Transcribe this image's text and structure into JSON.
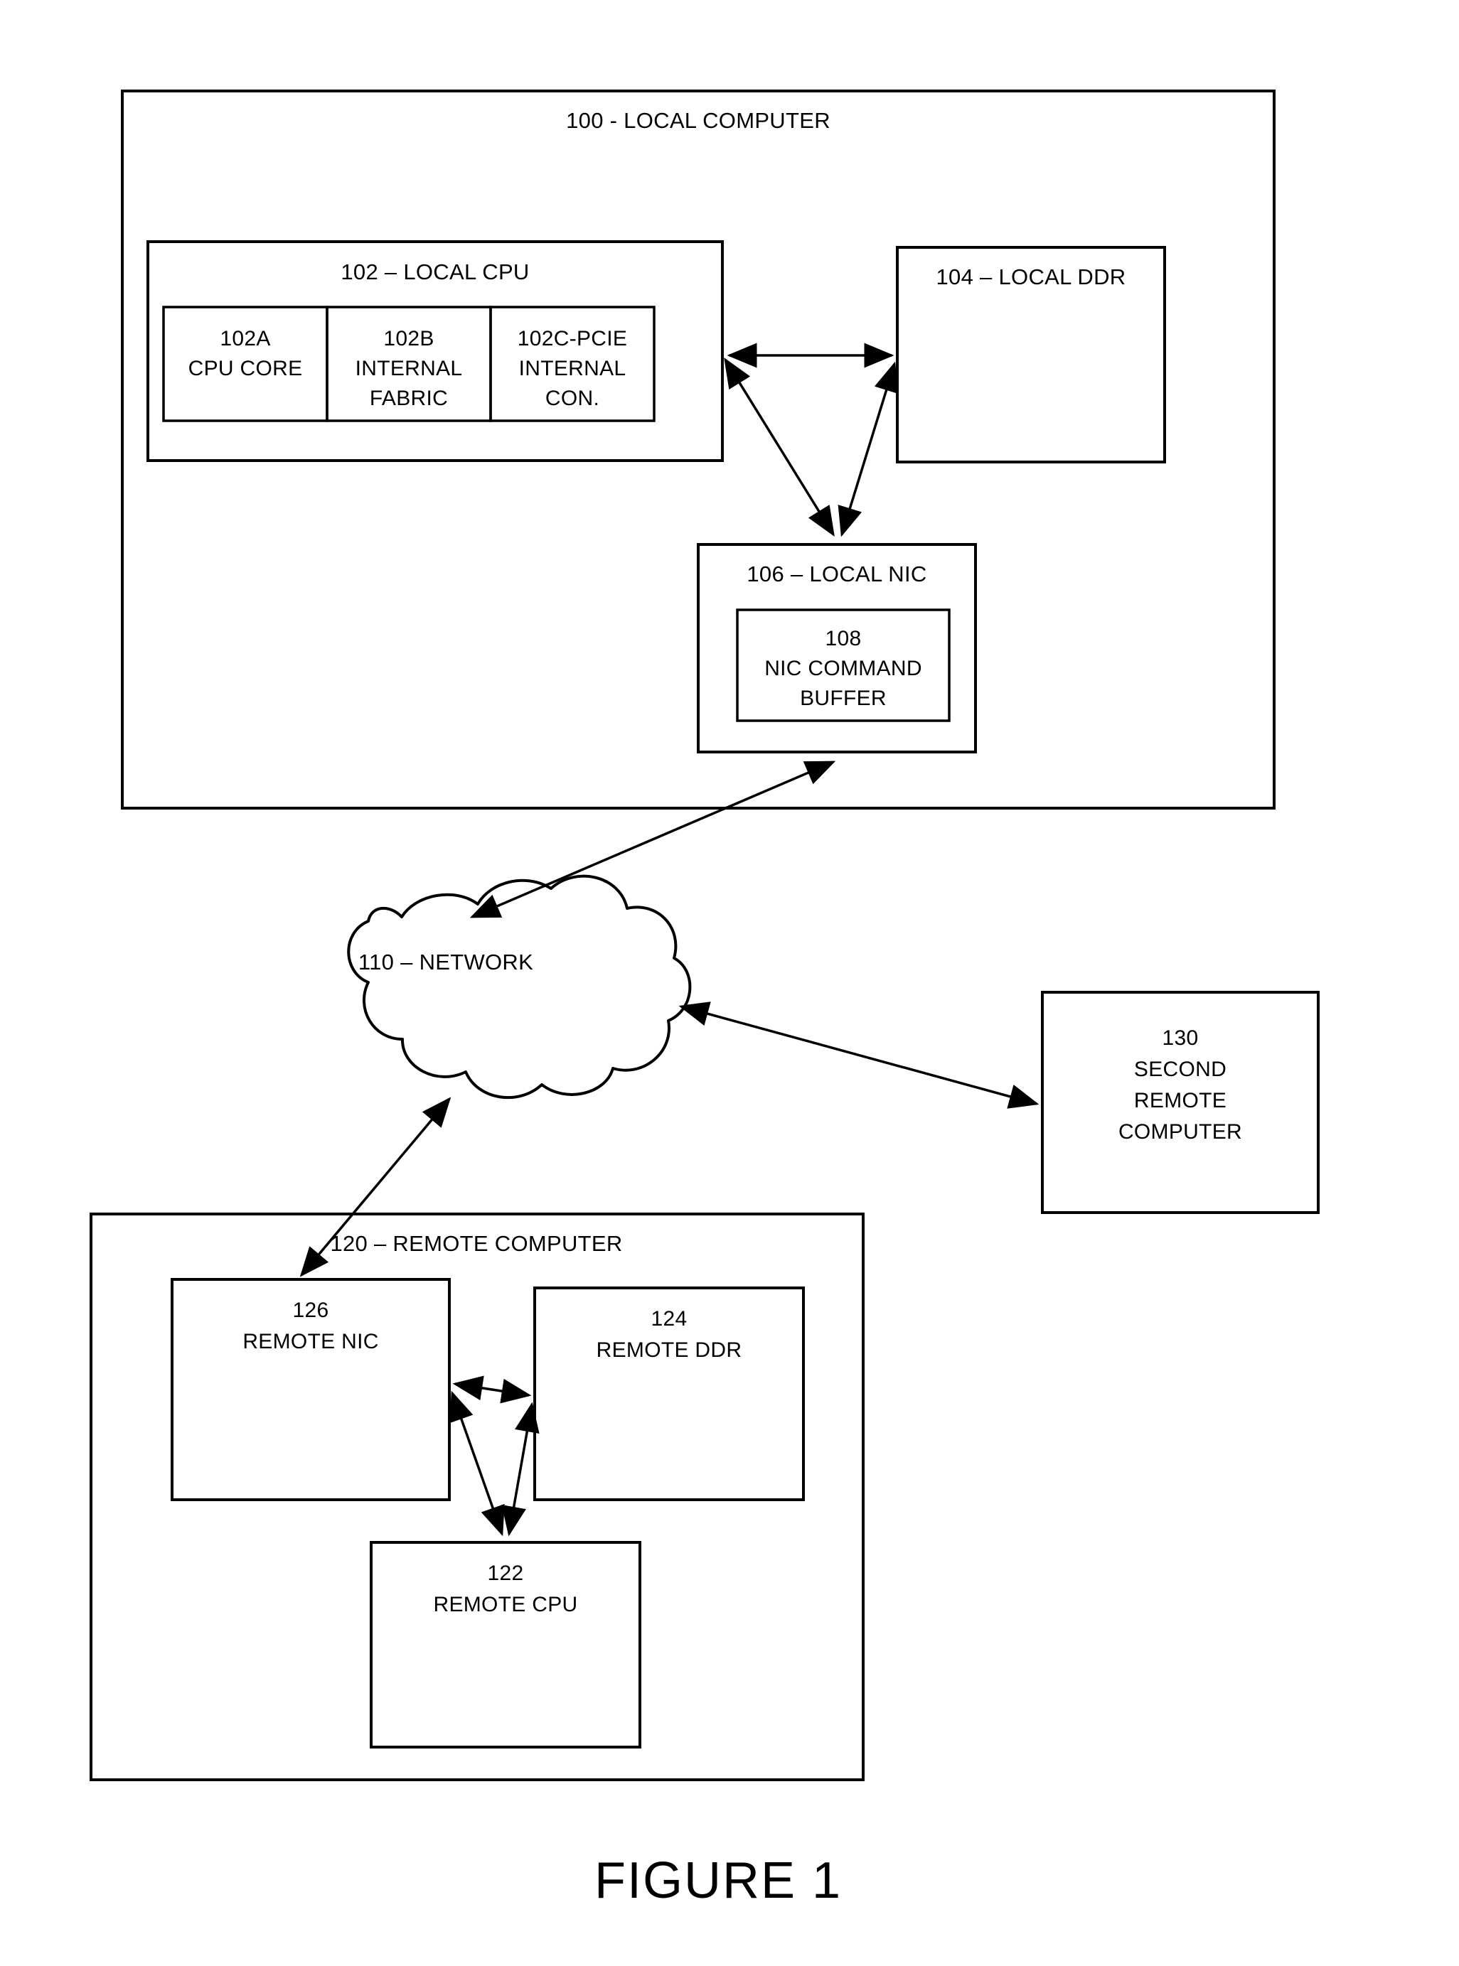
{
  "figure": {
    "caption": "FIGURE 1"
  },
  "local_computer": {
    "title": "100 - LOCAL COMPUTER",
    "cpu": {
      "title": "102 – LOCAL CPU",
      "blocks": [
        {
          "id": "102A",
          "line1": "102A",
          "line2": "CPU CORE",
          "line3": ""
        },
        {
          "id": "102B",
          "line1": "102B",
          "line2": "INTERNAL",
          "line3": "FABRIC"
        },
        {
          "id": "102C",
          "line1": "102C-PCIE",
          "line2": "INTERNAL",
          "line3": "CON."
        }
      ]
    },
    "ddr": {
      "title": "104 – LOCAL DDR"
    },
    "nic": {
      "title": "106 – LOCAL NIC",
      "command_buffer": {
        "line1": "108",
        "line2": "NIC COMMAND",
        "line3": "BUFFER"
      }
    }
  },
  "network": {
    "title": "110 – NETWORK"
  },
  "second_remote_computer": {
    "line1": "130",
    "line2": "SECOND",
    "line3": "REMOTE",
    "line4": "COMPUTER"
  },
  "remote_computer": {
    "title": "120 – REMOTE COMPUTER",
    "nic": {
      "line1": "126",
      "line2": "REMOTE NIC"
    },
    "ddr": {
      "line1": "124",
      "line2": "REMOTE DDR"
    },
    "cpu": {
      "line1": "122",
      "line2": "REMOTE CPU"
    }
  },
  "connections": [
    {
      "name": "local-cpu-to-local-ddr",
      "type": "bidirectional"
    },
    {
      "name": "local-cpu-to-local-nic",
      "type": "bidirectional"
    },
    {
      "name": "local-ddr-to-local-nic",
      "type": "bidirectional"
    },
    {
      "name": "local-nic-to-network",
      "type": "bidirectional"
    },
    {
      "name": "network-to-second-remote-computer",
      "type": "bidirectional"
    },
    {
      "name": "network-to-remote-nic",
      "type": "bidirectional"
    },
    {
      "name": "remote-nic-to-remote-ddr",
      "type": "bidirectional"
    },
    {
      "name": "remote-nic-to-remote-cpu",
      "type": "bidirectional"
    },
    {
      "name": "remote-ddr-to-remote-cpu",
      "type": "bidirectional"
    }
  ],
  "colors": {
    "stroke": "#000000",
    "background": "#ffffff"
  }
}
